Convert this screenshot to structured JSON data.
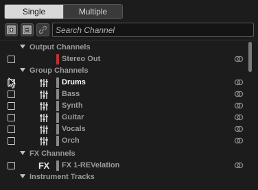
{
  "tabs": {
    "single": "Single",
    "multiple": "Multiple",
    "selected": "single"
  },
  "toolbar": {
    "expand_icon": "expand-all-icon",
    "collapse_icon": "collapse-all-icon",
    "link_icon": "link-icon",
    "search_placeholder": "Search Channel",
    "search_value": ""
  },
  "sections": {
    "output": "Output Channels",
    "group": "Group Channels",
    "fx": "FX Channels",
    "instrument": "Instrument Tracks"
  },
  "channels": {
    "stereo_out": {
      "name": "Stereo Out",
      "color": "#b83232",
      "checked": false
    },
    "drums": {
      "name": "Drums",
      "color": "#888888",
      "checked": true,
      "active": true
    },
    "bass": {
      "name": "Bass",
      "color": "#888888",
      "checked": false
    },
    "synth": {
      "name": "Synth",
      "color": "#888888",
      "checked": false
    },
    "guitar": {
      "name": "Guitar",
      "color": "#888888",
      "checked": false
    },
    "vocals": {
      "name": "Vocals",
      "color": "#888888",
      "checked": false
    },
    "orch": {
      "name": "Orch",
      "color": "#888888",
      "checked": false
    },
    "fx1": {
      "name": "FX 1-REVelation",
      "icon_text": "FX",
      "color": "#888888",
      "checked": false
    }
  },
  "colors": {
    "background": "#1c1c1c",
    "active_tab": "#d8d8d8",
    "stereo_out_bar": "#b83232"
  }
}
